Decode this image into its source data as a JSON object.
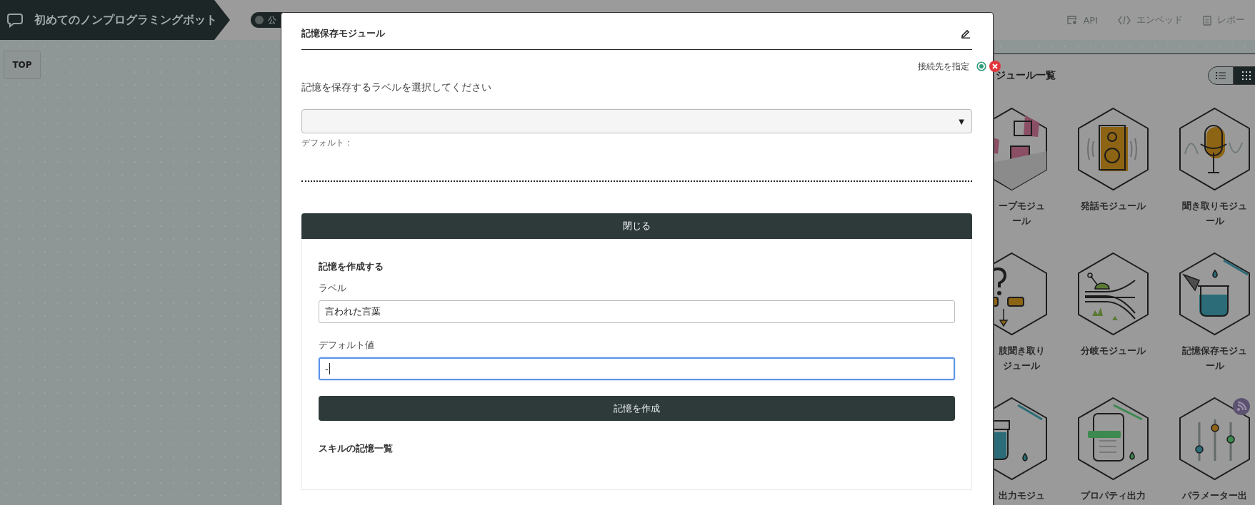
{
  "header": {
    "title": "初めてのノンプログラミングボット",
    "publish": {
      "label": "公",
      "on": false
    },
    "nav": [
      {
        "kind": "api",
        "label": "API"
      },
      {
        "kind": "embed",
        "label": "エンベッド"
      },
      {
        "kind": "report",
        "label": "レポー"
      }
    ]
  },
  "canvas": {
    "top_button": "TOP"
  },
  "module_panel": {
    "title": "ジュール一覧",
    "views": [
      {
        "kind": "list",
        "selected": false
      },
      {
        "kind": "grid",
        "selected": true
      }
    ],
    "modules": [
      {
        "lines": [
          "ープモジュ",
          "ール"
        ],
        "badge": false
      },
      {
        "lines": [
          "発話モジュール"
        ],
        "badge": false
      },
      {
        "lines": [
          "聞き取りモジュ",
          "ール"
        ],
        "badge": false
      },
      {
        "lines": [
          "肢聞き取り",
          "ジュール"
        ],
        "badge": false
      },
      {
        "lines": [
          "分岐モジュール"
        ],
        "badge": false
      },
      {
        "lines": [
          "記憶保存モジュ",
          "ール"
        ],
        "badge": false
      },
      {
        "lines": [
          "出力モジュ"
        ],
        "badge": false
      },
      {
        "lines": [
          "プロパティ出力"
        ],
        "badge": false
      },
      {
        "lines": [
          "パラメーター出"
        ],
        "badge": true
      }
    ]
  },
  "modal": {
    "title": "記憶保存モジュール",
    "connect_label": "接続先を指定",
    "prompt": "記憶を保存するラベルを選択してください",
    "select_arrow": "▼",
    "default_note": "デフォルト：",
    "close_button": "閉じる",
    "create": {
      "heading": "記憶を作成する",
      "fields": [
        {
          "label": "ラベル",
          "value": "言われた言葉",
          "focused": false
        },
        {
          "label": "デフォルト値",
          "value": "-",
          "focused": true
        }
      ],
      "button": "記憶を作成",
      "list_heading": "スキルの記憶一覧"
    }
  }
}
